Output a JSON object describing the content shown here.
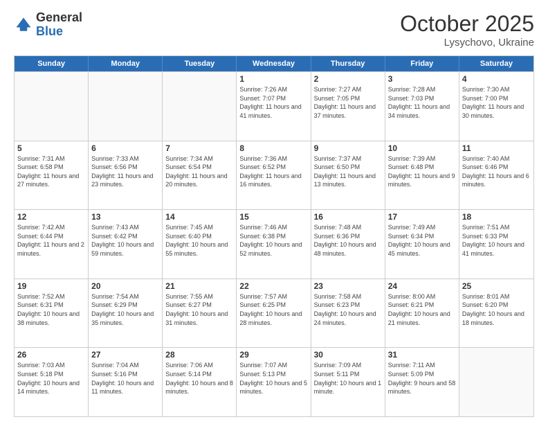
{
  "header": {
    "logo_general": "General",
    "logo_blue": "Blue",
    "month_title": "October 2025",
    "subtitle": "Lysychovo, Ukraine"
  },
  "weekdays": [
    "Sunday",
    "Monday",
    "Tuesday",
    "Wednesday",
    "Thursday",
    "Friday",
    "Saturday"
  ],
  "weeks": [
    [
      {
        "day": "",
        "info": ""
      },
      {
        "day": "",
        "info": ""
      },
      {
        "day": "",
        "info": ""
      },
      {
        "day": "1",
        "info": "Sunrise: 7:26 AM\nSunset: 7:07 PM\nDaylight: 11 hours and 41 minutes."
      },
      {
        "day": "2",
        "info": "Sunrise: 7:27 AM\nSunset: 7:05 PM\nDaylight: 11 hours and 37 minutes."
      },
      {
        "day": "3",
        "info": "Sunrise: 7:28 AM\nSunset: 7:03 PM\nDaylight: 11 hours and 34 minutes."
      },
      {
        "day": "4",
        "info": "Sunrise: 7:30 AM\nSunset: 7:00 PM\nDaylight: 11 hours and 30 minutes."
      }
    ],
    [
      {
        "day": "5",
        "info": "Sunrise: 7:31 AM\nSunset: 6:58 PM\nDaylight: 11 hours and 27 minutes."
      },
      {
        "day": "6",
        "info": "Sunrise: 7:33 AM\nSunset: 6:56 PM\nDaylight: 11 hours and 23 minutes."
      },
      {
        "day": "7",
        "info": "Sunrise: 7:34 AM\nSunset: 6:54 PM\nDaylight: 11 hours and 20 minutes."
      },
      {
        "day": "8",
        "info": "Sunrise: 7:36 AM\nSunset: 6:52 PM\nDaylight: 11 hours and 16 minutes."
      },
      {
        "day": "9",
        "info": "Sunrise: 7:37 AM\nSunset: 6:50 PM\nDaylight: 11 hours and 13 minutes."
      },
      {
        "day": "10",
        "info": "Sunrise: 7:39 AM\nSunset: 6:48 PM\nDaylight: 11 hours and 9 minutes."
      },
      {
        "day": "11",
        "info": "Sunrise: 7:40 AM\nSunset: 6:46 PM\nDaylight: 11 hours and 6 minutes."
      }
    ],
    [
      {
        "day": "12",
        "info": "Sunrise: 7:42 AM\nSunset: 6:44 PM\nDaylight: 11 hours and 2 minutes."
      },
      {
        "day": "13",
        "info": "Sunrise: 7:43 AM\nSunset: 6:42 PM\nDaylight: 10 hours and 59 minutes."
      },
      {
        "day": "14",
        "info": "Sunrise: 7:45 AM\nSunset: 6:40 PM\nDaylight: 10 hours and 55 minutes."
      },
      {
        "day": "15",
        "info": "Sunrise: 7:46 AM\nSunset: 6:38 PM\nDaylight: 10 hours and 52 minutes."
      },
      {
        "day": "16",
        "info": "Sunrise: 7:48 AM\nSunset: 6:36 PM\nDaylight: 10 hours and 48 minutes."
      },
      {
        "day": "17",
        "info": "Sunrise: 7:49 AM\nSunset: 6:34 PM\nDaylight: 10 hours and 45 minutes."
      },
      {
        "day": "18",
        "info": "Sunrise: 7:51 AM\nSunset: 6:33 PM\nDaylight: 10 hours and 41 minutes."
      }
    ],
    [
      {
        "day": "19",
        "info": "Sunrise: 7:52 AM\nSunset: 6:31 PM\nDaylight: 10 hours and 38 minutes."
      },
      {
        "day": "20",
        "info": "Sunrise: 7:54 AM\nSunset: 6:29 PM\nDaylight: 10 hours and 35 minutes."
      },
      {
        "day": "21",
        "info": "Sunrise: 7:55 AM\nSunset: 6:27 PM\nDaylight: 10 hours and 31 minutes."
      },
      {
        "day": "22",
        "info": "Sunrise: 7:57 AM\nSunset: 6:25 PM\nDaylight: 10 hours and 28 minutes."
      },
      {
        "day": "23",
        "info": "Sunrise: 7:58 AM\nSunset: 6:23 PM\nDaylight: 10 hours and 24 minutes."
      },
      {
        "day": "24",
        "info": "Sunrise: 8:00 AM\nSunset: 6:21 PM\nDaylight: 10 hours and 21 minutes."
      },
      {
        "day": "25",
        "info": "Sunrise: 8:01 AM\nSunset: 6:20 PM\nDaylight: 10 hours and 18 minutes."
      }
    ],
    [
      {
        "day": "26",
        "info": "Sunrise: 7:03 AM\nSunset: 5:18 PM\nDaylight: 10 hours and 14 minutes."
      },
      {
        "day": "27",
        "info": "Sunrise: 7:04 AM\nSunset: 5:16 PM\nDaylight: 10 hours and 11 minutes."
      },
      {
        "day": "28",
        "info": "Sunrise: 7:06 AM\nSunset: 5:14 PM\nDaylight: 10 hours and 8 minutes."
      },
      {
        "day": "29",
        "info": "Sunrise: 7:07 AM\nSunset: 5:13 PM\nDaylight: 10 hours and 5 minutes."
      },
      {
        "day": "30",
        "info": "Sunrise: 7:09 AM\nSunset: 5:11 PM\nDaylight: 10 hours and 1 minute."
      },
      {
        "day": "31",
        "info": "Sunrise: 7:11 AM\nSunset: 5:09 PM\nDaylight: 9 hours and 58 minutes."
      },
      {
        "day": "",
        "info": ""
      }
    ]
  ]
}
